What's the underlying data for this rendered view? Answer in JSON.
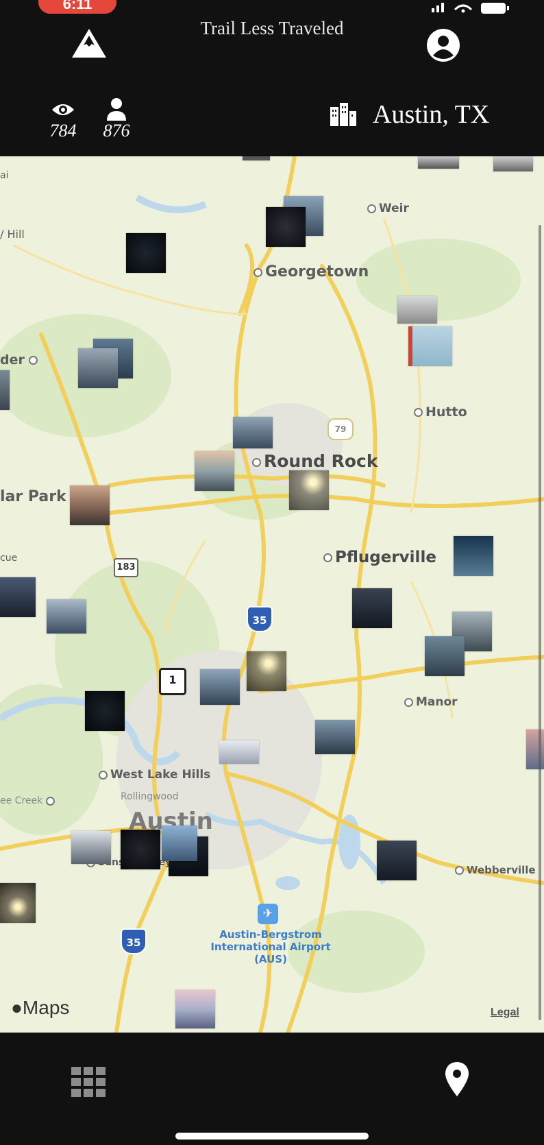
{
  "status_bar": {
    "time": "6:11"
  },
  "header": {
    "title": "Trail Less Traveled",
    "views_count": "784",
    "users_count": "876",
    "city": "Austin, TX"
  },
  "map": {
    "places": {
      "weir": "Weir",
      "georgetown": "Georgetown",
      "hutto": "Hutto",
      "round_rock": "Round Rock",
      "cedar_park": "lar Park",
      "leander": "der",
      "hill": "/ Hill",
      "pflugerville": "Pflugerville",
      "manor": "Manor",
      "west_lake_hills": "West Lake Hills",
      "rollingwood": "Rollingwood",
      "austin": "Austin",
      "sunset_valley": "Sunset Valley",
      "webberville": "Webberville",
      "airport": "Austin-Bergstrom International Airport (AUS)",
      "bee_cave": "ee Creek",
      "left_a": "ai",
      "left_b": "cue"
    },
    "shields": {
      "us183": "183",
      "i35": "35",
      "loop1": "1",
      "us79": "79",
      "i35s": "35"
    },
    "attribution": "Maps",
    "legal": "Legal"
  },
  "colors": {
    "header_bg": "#111111",
    "map_bg": "#eef1dc",
    "road": "#f2cf5b",
    "accent": "#e5483b"
  }
}
